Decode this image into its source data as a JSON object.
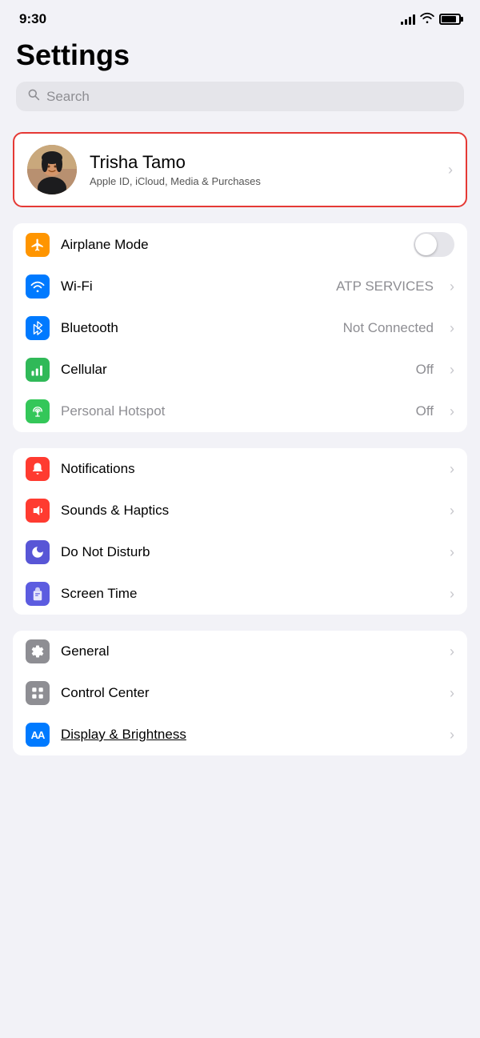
{
  "statusBar": {
    "time": "9:30",
    "battery": 85
  },
  "header": {
    "title": "Settings",
    "search": {
      "placeholder": "Search"
    }
  },
  "profile": {
    "name": "Trisha Tamo",
    "subtitle": "Apple ID, iCloud, Media & Purchases"
  },
  "sections": [
    {
      "id": "connectivity",
      "rows": [
        {
          "id": "airplane-mode",
          "label": "Airplane Mode",
          "iconColor": "orange",
          "iconType": "airplane",
          "hasToggle": true,
          "toggleOn": false,
          "value": "",
          "hasChevron": false
        },
        {
          "id": "wifi",
          "label": "Wi-Fi",
          "iconColor": "blue",
          "iconType": "wifi",
          "hasToggle": false,
          "value": "ATP SERVICES",
          "hasChevron": true
        },
        {
          "id": "bluetooth",
          "label": "Bluetooth",
          "iconColor": "blue",
          "iconType": "bluetooth",
          "hasToggle": false,
          "value": "Not Connected",
          "hasChevron": true
        },
        {
          "id": "cellular",
          "label": "Cellular",
          "iconColor": "green-cell",
          "iconType": "cellular",
          "hasToggle": false,
          "value": "Off",
          "hasChevron": true
        },
        {
          "id": "hotspot",
          "label": "Personal Hotspot",
          "iconColor": "green-hs",
          "iconType": "hotspot",
          "hasToggle": false,
          "value": "Off",
          "hasChevron": true,
          "dimmed": true
        }
      ]
    },
    {
      "id": "notifications",
      "rows": [
        {
          "id": "notifications",
          "label": "Notifications",
          "iconColor": "red",
          "iconType": "notifications",
          "hasToggle": false,
          "value": "",
          "hasChevron": true
        },
        {
          "id": "sounds",
          "label": "Sounds & Haptics",
          "iconColor": "red-sound",
          "iconType": "sound",
          "hasToggle": false,
          "value": "",
          "hasChevron": true
        },
        {
          "id": "donotdisturb",
          "label": "Do Not Disturb",
          "iconColor": "purple",
          "iconType": "moon",
          "hasToggle": false,
          "value": "",
          "hasChevron": true
        },
        {
          "id": "screentime",
          "label": "Screen Time",
          "iconColor": "indigo",
          "iconType": "hourglass",
          "hasToggle": false,
          "value": "",
          "hasChevron": true
        }
      ]
    },
    {
      "id": "system",
      "rows": [
        {
          "id": "general",
          "label": "General",
          "iconColor": "gray",
          "iconType": "gear",
          "hasToggle": false,
          "value": "",
          "hasChevron": true
        },
        {
          "id": "controlcenter",
          "label": "Control Center",
          "iconColor": "gray2",
          "iconType": "sliders",
          "hasToggle": false,
          "value": "",
          "hasChevron": true
        },
        {
          "id": "display",
          "label": "Display & Brightness",
          "iconColor": "blue-aa",
          "iconType": "aa",
          "hasToggle": false,
          "value": "",
          "hasChevron": true
        }
      ]
    }
  ],
  "icons": {
    "airplane": "✈",
    "wifi": "📶",
    "bluetooth": "B",
    "cellular": "((·))",
    "hotspot": "∞",
    "notifications": "🔔",
    "sound": "🔊",
    "moon": "☽",
    "hourglass": "⏳",
    "gear": "⚙",
    "sliders": "⊟",
    "aa": "AA"
  }
}
